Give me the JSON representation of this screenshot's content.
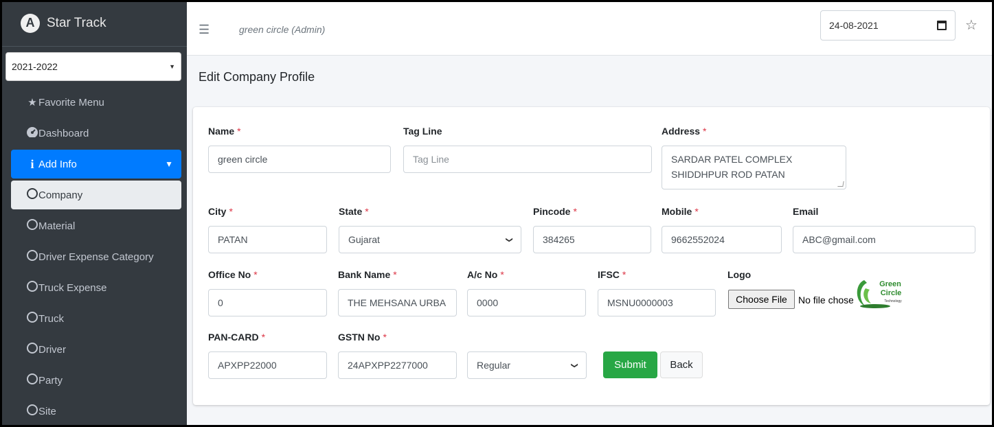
{
  "brand": {
    "name": "Star Track",
    "logo_letter": "A"
  },
  "year_select": {
    "value": "2021-2022"
  },
  "sidebar": {
    "items": [
      {
        "label": "Favorite Menu",
        "icon": "star-icon"
      },
      {
        "label": "Dashboard",
        "icon": "dashboard-icon"
      },
      {
        "label": "Add Info",
        "icon": "info-icon"
      },
      {
        "label": "Company",
        "icon": "circle-icon"
      },
      {
        "label": "Material",
        "icon": "circle-icon"
      },
      {
        "label": "Driver Expense Category",
        "icon": "circle-icon"
      },
      {
        "label": "Truck Expense",
        "icon": "circle-icon"
      },
      {
        "label": "Truck",
        "icon": "circle-icon"
      },
      {
        "label": "Driver",
        "icon": "circle-icon"
      },
      {
        "label": "Party",
        "icon": "circle-icon"
      },
      {
        "label": "Site",
        "icon": "circle-icon"
      }
    ]
  },
  "header": {
    "user_label": "green circle (Admin)",
    "date": "24-08-2021"
  },
  "page": {
    "title": "Edit Company Profile"
  },
  "form": {
    "name": {
      "label": "Name",
      "value": "green circle"
    },
    "tag_line": {
      "label": "Tag Line",
      "placeholder": "Tag Line"
    },
    "address": {
      "label": "Address",
      "line1": "SARDAR PATEL COMPLEX",
      "line2": "SHIDDHPUR ROD PATAN"
    },
    "city": {
      "label": "City",
      "value": "PATAN"
    },
    "state": {
      "label": "State",
      "value": "Gujarat"
    },
    "pincode": {
      "label": "Pincode",
      "value": "384265"
    },
    "mobile": {
      "label": "Mobile",
      "value": "9662552024"
    },
    "email": {
      "label": "Email",
      "value": "ABC@gmail.com"
    },
    "office_no": {
      "label": "Office No",
      "value": "0"
    },
    "bank_name": {
      "label": "Bank Name",
      "value": "THE MEHSANA URBA"
    },
    "ac_no": {
      "label": "A/c No",
      "value": "0000"
    },
    "ifsc": {
      "label": "IFSC",
      "value": "MSNU0000003"
    },
    "logo": {
      "label": "Logo",
      "button": "Choose File",
      "status": "No file chose",
      "brand_line1": "Green",
      "brand_line2": "Circle",
      "brand_line3": "Technology"
    },
    "pan": {
      "label": "PAN-CARD",
      "value": "APXPP22000"
    },
    "gstn": {
      "label": "GSTN No",
      "value": "24APXPP2277000"
    },
    "gst_type": {
      "value": "Regular"
    },
    "required_mark": "*",
    "submit": "Submit",
    "back": "Back"
  },
  "colors": {
    "sidebar_bg": "#343a40",
    "primary": "#007bff",
    "success": "#28a745",
    "required": "#dc3545"
  }
}
